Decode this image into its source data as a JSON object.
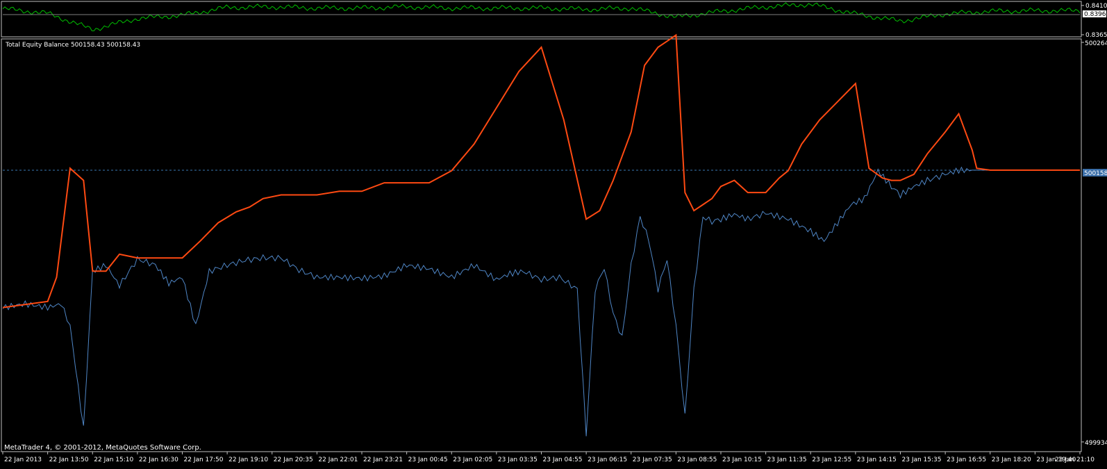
{
  "window": {
    "copyright": "MetaTrader 4, © 2001-2012, MetaQuotes Software Corp."
  },
  "colors": {
    "background": "#000000",
    "frame": "#c0c0c0",
    "text": "#ffffff",
    "price_line": "#00c000",
    "equity": "#4f86c6",
    "balance": "#ff4a12",
    "current_level": "#3a78b5",
    "current_tag_bg": "#3a6ea8"
  },
  "price_panel": {
    "ticks": [
      "0.8410",
      "0.8396",
      "0.8365"
    ],
    "current_label": "0.8396"
  },
  "indicator_panel": {
    "title": "Total Equity Balance 500158.43 500158.43",
    "ticks": [
      "500264.",
      "499934."
    ],
    "current_label": "500158."
  },
  "chart_data": [
    {
      "type": "line",
      "title": "",
      "y_ticks": [
        "0.8410",
        "0.8396",
        "0.8365"
      ],
      "ylim": [
        0.8365,
        0.8412
      ],
      "current_value": 0.8396,
      "grid": false,
      "series": [
        {
          "name": "",
          "x": [
            "22 Jan 2013",
            "22 Jan 13:50",
            "22 Jan 15:10",
            "22 Jan 16:30",
            "22 Jan 17:50",
            "22 Jan 19:10",
            "22 Jan 20:35",
            "22 Jan 22:01",
            "22 Jan 23:21",
            "23 Jan 00:45",
            "23 Jan 02:05",
            "23 Jan 03:35",
            "23 Jan 04:55",
            "23 Jan 06:15",
            "23 Jan 07:35",
            "23 Jan 08:55",
            "23 Jan 10:15",
            "23 Jan 11:35",
            "23 Jan 12:55",
            "23 Jan 14:15",
            "23 Jan 15:35",
            "23 Jan 16:55",
            "23 Jan 18:20",
            "23 Jan 19:40",
            "23 Jan 21:10"
          ],
          "values": [
            0.8405,
            0.8398,
            0.8373,
            0.839,
            0.8395,
            0.8407,
            0.8408,
            0.8406,
            0.8406,
            0.8408,
            0.8406,
            0.8406,
            0.8406,
            0.8404,
            0.8406,
            0.8392,
            0.8401,
            0.8408,
            0.8412,
            0.8397,
            0.8386,
            0.8397,
            0.8401,
            0.8402,
            0.8402
          ]
        }
      ]
    },
    {
      "type": "line",
      "title": "Total Equity Balance 500158.43 500158.43",
      "y_ticks": [
        "500264.",
        "499934."
      ],
      "ylim": [
        499934,
        500264
      ],
      "current_value": 500158.43,
      "grid": false,
      "x_ticks": [
        "22 Jan 2013",
        "22 Jan 13:50",
        "22 Jan 15:10",
        "22 Jan 16:30",
        "22 Jan 17:50",
        "22 Jan 19:10",
        "22 Jan 20:35",
        "22 Jan 22:01",
        "22 Jan 23:21",
        "23 Jan 00:45",
        "23 Jan 02:05",
        "23 Jan 03:35",
        "23 Jan 04:55",
        "23 Jan 06:15",
        "23 Jan 07:35",
        "23 Jan 08:55",
        "23 Jan 10:15",
        "23 Jan 11:35",
        "23 Jan 12:55",
        "23 Jan 14:15",
        "23 Jan 15:35",
        "23 Jan 16:55",
        "23 Jan 18:20",
        "23 Jan 19:40",
        "23 Jan 21:10"
      ],
      "series": [
        {
          "name": "",
          "color": "#4f86c6",
          "x": [
            0,
            0.5,
            1,
            1.3,
            1.5,
            1.8,
            2,
            2.3,
            2.6,
            3,
            3.4,
            3.7,
            4,
            4.3,
            4.6,
            5,
            5.4,
            5.8,
            6.2,
            6.6,
            7,
            7.5,
            8,
            8.5,
            9,
            9.5,
            10,
            10.5,
            11,
            11.3,
            11.6,
            12,
            12.4,
            12.8,
            13,
            13.2,
            13.4,
            13.6,
            13.8,
            14,
            14.2,
            14.4,
            14.6,
            14.8,
            15,
            15.2,
            15.4,
            15.6,
            15.8,
            16,
            16.3,
            16.6,
            17,
            17.5,
            18,
            18.3,
            18.6,
            18.9,
            19.2,
            19.5,
            19.8,
            20,
            20.3,
            20.6,
            21,
            21.3,
            21.6,
            22,
            23,
            24
          ],
          "values": [
            500045,
            500048,
            500045,
            500048,
            500030,
            499945,
            500075,
            500080,
            500063,
            500085,
            500080,
            500065,
            500070,
            500030,
            500075,
            500080,
            500084,
            500086,
            500086,
            500076,
            500070,
            500070,
            500069,
            500071,
            500080,
            500077,
            500070,
            500080,
            500068,
            500073,
            500075,
            500068,
            500070,
            500060,
            499940,
            500060,
            500078,
            500040,
            500020,
            500080,
            500120,
            500100,
            500060,
            500085,
            500030,
            499955,
            500060,
            500120,
            500116,
            500118,
            500122,
            500118,
            500123,
            500118,
            500108,
            500100,
            500115,
            500130,
            500135,
            500158,
            500145,
            500138,
            500145,
            500150,
            500155,
            500158.43,
            500158.43,
            500158.43,
            500158.43,
            500158.43
          ]
        },
        {
          "name": "",
          "color": "#ff4a12",
          "x": [
            0,
            1,
            1.2,
            1.5,
            1.8,
            2,
            2.3,
            2.6,
            3,
            3.3,
            3.6,
            4,
            4.4,
            4.8,
            5.2,
            5.5,
            5.8,
            6.2,
            6.6,
            7,
            7.5,
            8,
            8.5,
            9,
            9.5,
            10,
            10.5,
            11,
            11.5,
            12,
            12.5,
            13,
            13.3,
            13.6,
            14,
            14.3,
            14.6,
            14.8,
            15,
            15.2,
            15.4,
            15.6,
            15.8,
            16,
            16.3,
            16.6,
            17,
            17.3,
            17.5,
            17.8,
            18.2,
            18.6,
            19,
            19.3,
            19.6,
            19.8,
            20,
            20.3,
            20.6,
            21,
            21.3,
            21.6,
            21.7,
            22,
            23,
            24
          ],
          "values": [
            500045,
            500050,
            500070,
            500160,
            500150,
            500075,
            500075,
            500089,
            500086,
            500086,
            500086,
            500086,
            500100,
            500115,
            500124,
            500128,
            500135,
            500138,
            500138,
            500138,
            500141,
            500141,
            500148,
            500148,
            500148,
            500158,
            500180,
            500210,
            500240,
            500260,
            500200,
            500118,
            500125,
            500150,
            500190,
            500245,
            500260,
            500265,
            500270,
            500140,
            500125,
            500130,
            500135,
            500145,
            500150,
            500140,
            500140,
            500152,
            500158,
            500180,
            500200,
            500215,
            500230,
            500160,
            500152,
            500150,
            500150,
            500155,
            500172,
            500190,
            500205,
            500175,
            500160,
            500158.43,
            500158.43,
            500158.43
          ]
        }
      ]
    }
  ]
}
